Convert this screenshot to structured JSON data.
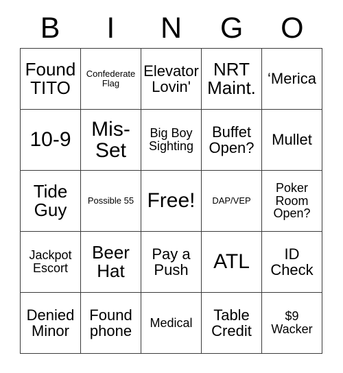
{
  "card": {
    "headers": [
      "B",
      "I",
      "N",
      "G",
      "O"
    ],
    "rows": [
      [
        {
          "text": "Found TITO",
          "size": "lg"
        },
        {
          "text": "Confederate Flag",
          "size": "xs"
        },
        {
          "text": "Elevator Lovin'",
          "size": "md"
        },
        {
          "text": "NRT Maint.",
          "size": "lg"
        },
        {
          "text": "‘Merica",
          "size": "md"
        }
      ],
      [
        {
          "text": "10-9",
          "size": "xl"
        },
        {
          "text": "Mis-Set",
          "size": "xl"
        },
        {
          "text": "Big Boy Sighting",
          "size": "sm"
        },
        {
          "text": "Buffet Open?",
          "size": "md"
        },
        {
          "text": "Mullet",
          "size": "md"
        }
      ],
      [
        {
          "text": "Tide Guy",
          "size": "lg"
        },
        {
          "text": "Possible 55",
          "size": "xs"
        },
        {
          "text": "Free!",
          "size": "xl"
        },
        {
          "text": "DAP/VEP",
          "size": "xs"
        },
        {
          "text": "Poker Room Open?",
          "size": "sm"
        }
      ],
      [
        {
          "text": "Jackpot Escort",
          "size": "sm"
        },
        {
          "text": "Beer Hat",
          "size": "lg"
        },
        {
          "text": "Pay a Push",
          "size": "md"
        },
        {
          "text": "ATL",
          "size": "xl"
        },
        {
          "text": "ID Check",
          "size": "md"
        }
      ],
      [
        {
          "text": "Denied Minor",
          "size": "md"
        },
        {
          "text": "Found phone",
          "size": "md"
        },
        {
          "text": "Medical",
          "size": "sm"
        },
        {
          "text": "Table Credit",
          "size": "md"
        },
        {
          "text": "$9 Wacker",
          "size": "sm"
        }
      ]
    ]
  }
}
